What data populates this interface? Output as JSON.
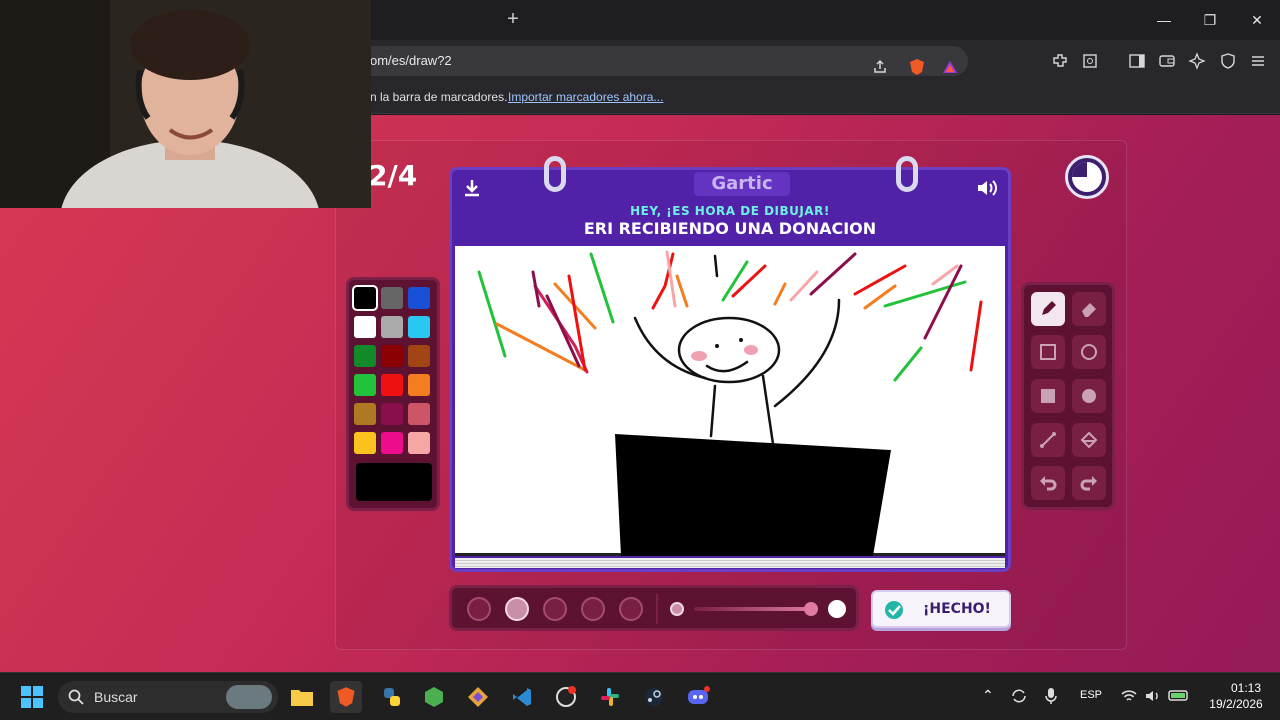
{
  "browser": {
    "url": "om/es/draw?2",
    "new_tab": "+",
    "bookmarks_text": "n la barra de marcadores.",
    "bookmarks_link": "Importar marcadores ahora..."
  },
  "game": {
    "round": "2/4",
    "logo": "Gartic",
    "heading": "HEY, ¡ES HORA DE DIBUJAR!",
    "prompt": "ERI RECIBIENDO UNA DONACION",
    "done_label": "¡HECHO!",
    "palette": [
      "#000000",
      "#666666",
      "#1a4fd8",
      "#ffffff",
      "#aaaaaa",
      "#29c8f0",
      "#138a2a",
      "#8b0000",
      "#a14515",
      "#22c33a",
      "#ee1111",
      "#f47d20",
      "#b07822",
      "#8a0e4a",
      "#cc5566",
      "#f9c21c",
      "#ec0c8c",
      "#f7a6a6"
    ],
    "selected_color": "#000000",
    "brush_sizes": 5,
    "selected_size_index": 1
  },
  "taskbar": {
    "search_label": "Buscar",
    "lang": "ESP",
    "time": "01:13",
    "date": "19/2/2026"
  }
}
